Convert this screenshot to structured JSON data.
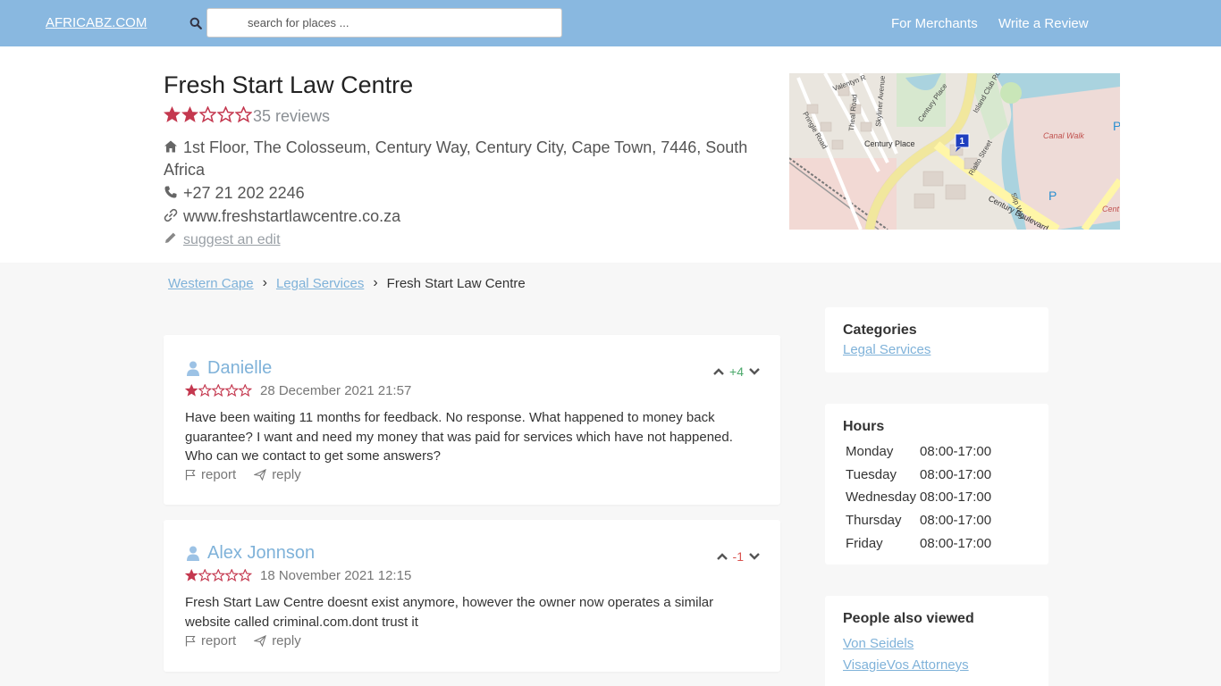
{
  "header": {
    "brand": "AFRICABZ.COM",
    "search_placeholder": "search for places ...",
    "nav": {
      "merchants": "For Merchants",
      "write_review": "Write a Review"
    }
  },
  "business": {
    "name": "Fresh Start Law Centre",
    "rating": 2,
    "max_rating": 5,
    "reviews_label": "35 reviews",
    "address": "1st Floor, The Colosseum, Century Way, Century City, Cape Town, 7446, South Africa",
    "phone": "+27 21 202 2246",
    "website": "www.freshstartlawcentre.co.za",
    "suggest_edit": "suggest an edit"
  },
  "map": {
    "labels": {
      "pringle": "Pringle Road",
      "theal": "Theal Road",
      "skyliner": "Skyliner Avenue",
      "valentyn": "Valentyn R",
      "century_place_1": "Century Place",
      "century_place_2": "Century Place",
      "island_club": "Island Club Road",
      "rialto": "Rialto Street",
      "slip_way": "Slip Way",
      "canal_walk": "Canal Walk",
      "century_blvd": "Century Boulevard",
      "cent": "Cent",
      "marker": "1",
      "parking_1": "P",
      "parking_2": "P"
    }
  },
  "breadcrumb": {
    "level1": "Western Cape",
    "level2": "Legal Services",
    "current": "Fresh Start Law Centre"
  },
  "reviews": [
    {
      "name": "Danielle",
      "rating": 1,
      "date": "28 December 2021 21:57",
      "votes": "+4",
      "text": "Have been waiting 11 months for feedback. No response. What happened to money back guarantee? I want and need my money that was paid for services which have not happened. Who can we contact to get some answers?",
      "report": "report",
      "reply": "reply"
    },
    {
      "name": "Alex Jonnson",
      "rating": 1,
      "date": "18 November 2021 12:15",
      "votes": "-1",
      "text": "Fresh Start Law Centre doesnt exist anymore, however the owner now operates a similar website called criminal.com.dont trust it",
      "report": "report",
      "reply": "reply"
    }
  ],
  "sidebar": {
    "categories": {
      "title": "Categories",
      "items": [
        "Legal Services"
      ]
    },
    "hours": {
      "title": "Hours",
      "rows": [
        {
          "day": "Monday",
          "time": "08:00-17:00"
        },
        {
          "day": "Tuesday",
          "time": "08:00-17:00"
        },
        {
          "day": "Wednesday",
          "time": "08:00-17:00"
        },
        {
          "day": "Thursday",
          "time": "08:00-17:00"
        },
        {
          "day": "Friday",
          "time": "08:00-17:00"
        }
      ]
    },
    "also_viewed": {
      "title": "People also viewed",
      "items": [
        "Von Seidels",
        "VisagieVos Attorneys"
      ]
    }
  },
  "colors": {
    "header_bg": "#89b8e0",
    "star": "#c4384f",
    "link": "#7fb2d9",
    "vote_positive": "#4aa86a",
    "vote_negative": "#d9534f"
  }
}
